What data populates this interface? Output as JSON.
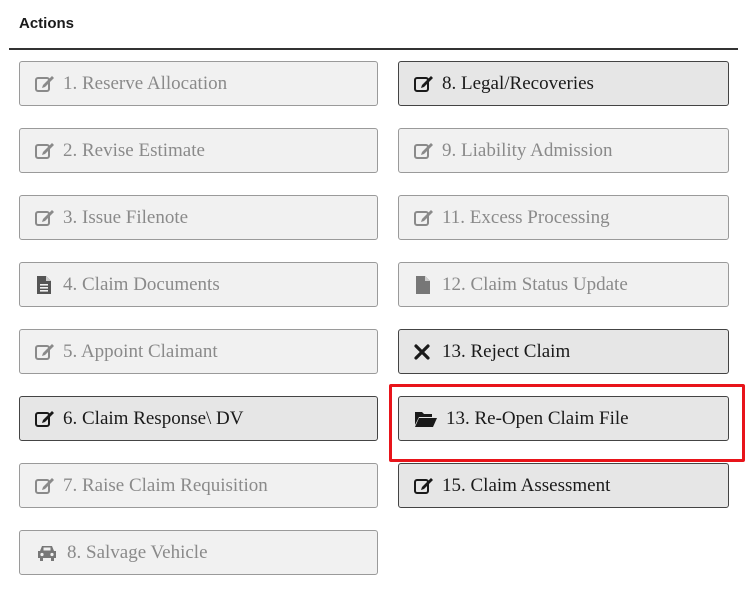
{
  "section": {
    "title": "Actions"
  },
  "buttons": {
    "reserve_allocation": "1. Reserve Allocation",
    "revise_estimate": "2. Revise Estimate",
    "issue_filenote": "3. Issue Filenote",
    "claim_documents": "4. Claim Documents",
    "appoint_claimant": "5. Appoint Claimant",
    "claim_response_dv": "6. Claim Response\\ DV",
    "raise_claim_requisition": "7. Raise Claim Requisition",
    "salvage_vehicle": "8. Salvage Vehicle",
    "legal_recoveries": "8. Legal/Recoveries",
    "liability_admission": "9. Liability Admission",
    "excess_processing": "11. Excess Processing",
    "claim_status_update": "12. Claim Status Update",
    "reject_claim": "13. Reject Claim",
    "reopen_claim_file": "13. Re-Open Claim File",
    "claim_assessment": "15. Claim Assessment"
  },
  "colors": {
    "disabled_text": "#8a8a8a",
    "enabled_text": "#1a1a1a",
    "highlight": "#e8141a"
  },
  "icons": {
    "edit": "edit-icon",
    "file": "file-icon",
    "car": "car-icon",
    "close": "close-icon",
    "folder_open": "folder-open-icon"
  }
}
